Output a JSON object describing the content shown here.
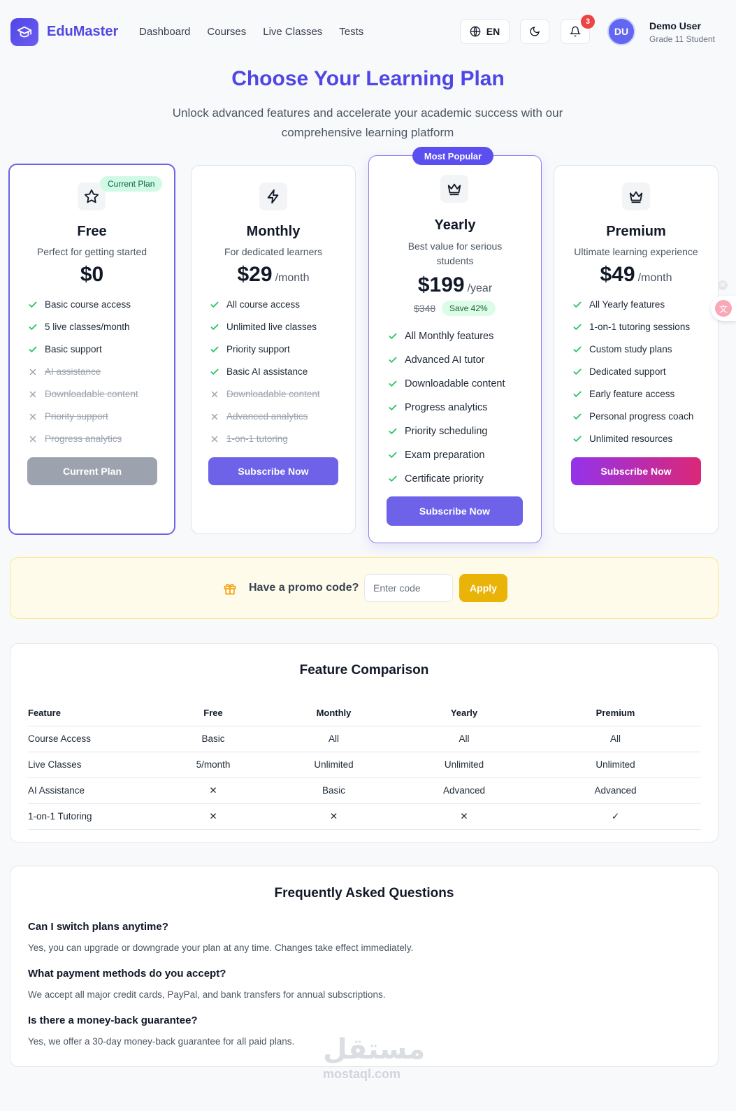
{
  "header": {
    "brand": "EduMaster",
    "nav": [
      "Dashboard",
      "Courses",
      "Live Classes",
      "Tests"
    ],
    "lang": "EN",
    "notification_count": "3",
    "avatar_initials": "DU",
    "user_name": "Demo User",
    "user_role": "Grade 11 Student"
  },
  "hero": {
    "title": "Choose Your Learning Plan",
    "subtitle": "Unlock advanced features and accelerate your academic success with our comprehensive learning platform"
  },
  "plans": [
    {
      "name": "Free",
      "desc": "Perfect for getting started",
      "price": "$0",
      "period": "",
      "badge": "Current Plan",
      "features": [
        {
          "text": "Basic course access",
          "on": true
        },
        {
          "text": "5 live classes/month",
          "on": true
        },
        {
          "text": "Basic support",
          "on": true
        },
        {
          "text": "AI assistance",
          "on": false
        },
        {
          "text": "Downloadable content",
          "on": false
        },
        {
          "text": "Priority support",
          "on": false
        },
        {
          "text": "Progress analytics",
          "on": false
        }
      ],
      "button": "Current Plan"
    },
    {
      "name": "Monthly",
      "desc": "For dedicated learners",
      "price": "$29",
      "period": "/month",
      "features": [
        {
          "text": "All course access",
          "on": true
        },
        {
          "text": "Unlimited live classes",
          "on": true
        },
        {
          "text": "Priority support",
          "on": true
        },
        {
          "text": "Basic AI assistance",
          "on": true
        },
        {
          "text": "Downloadable content",
          "on": false
        },
        {
          "text": "Advanced analytics",
          "on": false
        },
        {
          "text": "1-on-1 tutoring",
          "on": false
        }
      ],
      "button": "Subscribe Now"
    },
    {
      "name": "Yearly",
      "desc": "Best value for serious students",
      "price": "$199",
      "period": "/year",
      "badge": "Most Popular",
      "old_price": "$348",
      "save": "Save 42%",
      "features": [
        {
          "text": "All Monthly features",
          "on": true
        },
        {
          "text": "Advanced AI tutor",
          "on": true
        },
        {
          "text": "Downloadable content",
          "on": true
        },
        {
          "text": "Progress analytics",
          "on": true
        },
        {
          "text": "Priority scheduling",
          "on": true
        },
        {
          "text": "Exam preparation",
          "on": true
        },
        {
          "text": "Certificate priority",
          "on": true
        }
      ],
      "button": "Subscribe Now"
    },
    {
      "name": "Premium",
      "desc": "Ultimate learning experience",
      "price": "$49",
      "period": "/month",
      "features": [
        {
          "text": "All Yearly features",
          "on": true
        },
        {
          "text": "1-on-1 tutoring sessions",
          "on": true
        },
        {
          "text": "Custom study plans",
          "on": true
        },
        {
          "text": "Dedicated support",
          "on": true
        },
        {
          "text": "Early feature access",
          "on": true
        },
        {
          "text": "Personal progress coach",
          "on": true
        },
        {
          "text": "Unlimited resources",
          "on": true
        }
      ],
      "button": "Subscribe Now"
    }
  ],
  "promo": {
    "label": "Have a promo code?",
    "placeholder": "Enter code",
    "apply": "Apply"
  },
  "comparison": {
    "title": "Feature Comparison",
    "headers": [
      "Feature",
      "Free",
      "Monthly",
      "Yearly",
      "Premium"
    ],
    "rows": [
      [
        "Course Access",
        "Basic",
        "All",
        "All",
        "All"
      ],
      [
        "Live Classes",
        "5/month",
        "Unlimited",
        "Unlimited",
        "Unlimited"
      ],
      [
        "AI Assistance",
        "✕",
        "Basic",
        "Advanced",
        "Advanced"
      ],
      [
        "1-on-1 Tutoring",
        "✕",
        "✕",
        "✕",
        "✓"
      ]
    ]
  },
  "faq": {
    "title": "Frequently Asked Questions",
    "items": [
      {
        "q": "Can I switch plans anytime?",
        "a": "Yes, you can upgrade or downgrade your plan at any time. Changes take effect immediately."
      },
      {
        "q": "What payment methods do you accept?",
        "a": "We accept all major credit cards, PayPal, and bank transfers for annual subscriptions."
      },
      {
        "q": "Is there a money-back guarantee?",
        "a": "Yes, we offer a 30-day money-back guarantee for all paid plans."
      }
    ]
  },
  "watermark": {
    "arabic": "مستقل",
    "latin": "mostaql.com"
  },
  "colors": {
    "accent": "#4f46e5",
    "button": "#6d62e8",
    "check": "#22c55e",
    "cross": "#ef4444",
    "apply": "#eab308"
  }
}
